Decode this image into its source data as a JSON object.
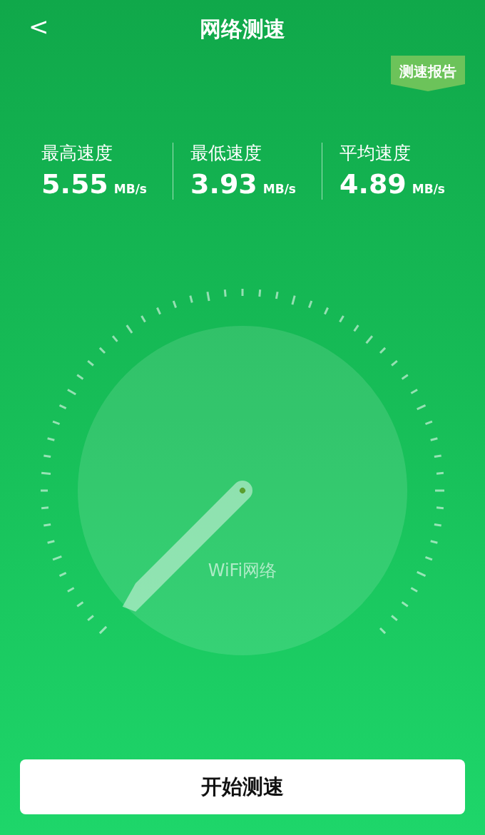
{
  "header": {
    "back_icon": "<",
    "title": "网络测速"
  },
  "report_badge": "测速报告",
  "stats": [
    {
      "label": "最高速度",
      "value": "5.55",
      "unit": "MB/s"
    },
    {
      "label": "最低速度",
      "value": "3.93",
      "unit": "MB/s"
    },
    {
      "label": "平均速度",
      "value": "4.89",
      "unit": "MB/s"
    }
  ],
  "gauge": {
    "network": "WiFi网络"
  },
  "start_button": "开始测速"
}
